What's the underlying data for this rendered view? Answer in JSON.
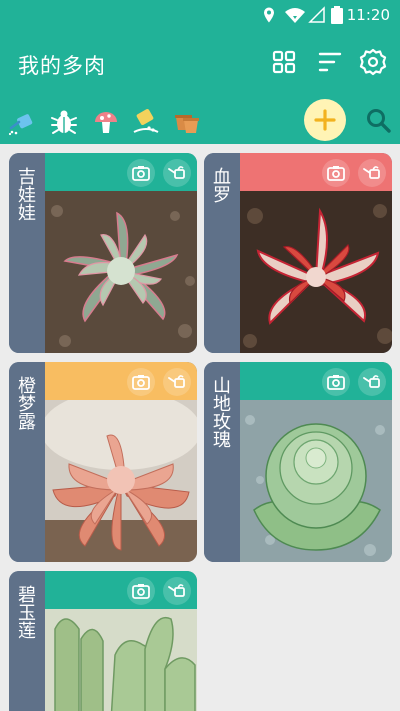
{
  "status_bar": {
    "time": "11:20"
  },
  "app_bar": {
    "title": "我的多肉"
  },
  "plants": [
    {
      "name": "吉娃娃",
      "header_color": "#21b298"
    },
    {
      "name": "血罗",
      "header_color": "#ee7373"
    },
    {
      "name": "橙梦露",
      "header_color": "#f8bd61"
    },
    {
      "name": "山地玫瑰",
      "header_color": "#21b298"
    },
    {
      "name": "碧玉莲",
      "header_color": "#21b298"
    }
  ],
  "colors": {
    "primary": "#21b298",
    "add_button": "#fff4b5",
    "add_plus": "#f2b21f",
    "name_column": "#5f7189"
  }
}
